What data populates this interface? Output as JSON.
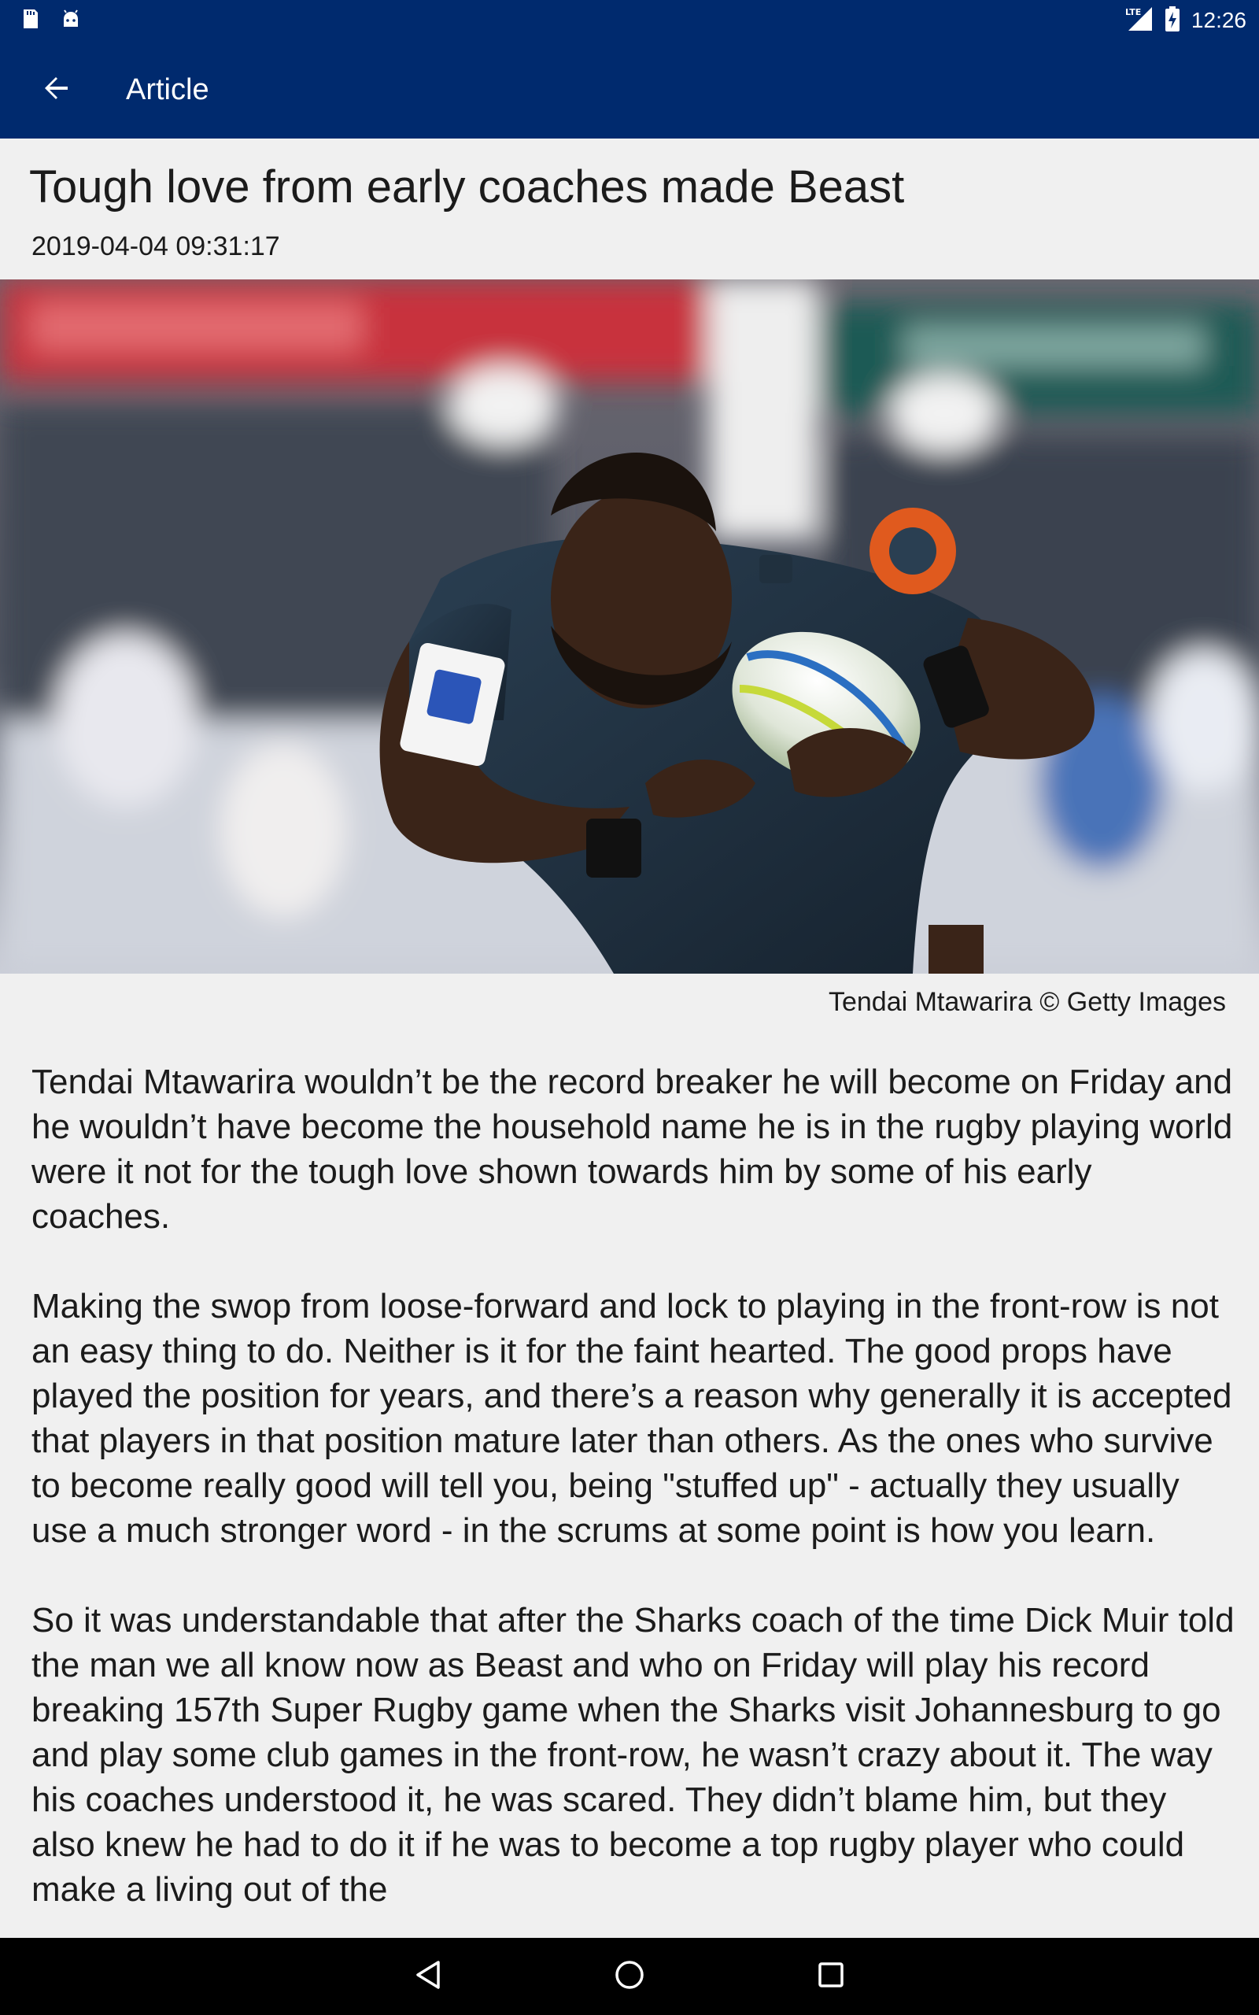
{
  "status_bar": {
    "time": "12:26",
    "left_icons": [
      "sd-card-icon",
      "android-icon"
    ],
    "right_icons": [
      "lte-signal-icon",
      "battery-charging-icon"
    ]
  },
  "app_bar": {
    "title": "Article",
    "back_icon": "arrow-back-icon",
    "background_color": "#002a6e"
  },
  "article": {
    "headline": "Tough love from early coaches made Beast",
    "timestamp": "2019-04-04 09:31:17",
    "image_caption": "Tendai Mtawarira © Getty Images",
    "paragraphs": [
      "Tendai Mtawarira wouldn’t be the record breaker he will become on Friday and he wouldn’t have become the household name he is in the rugby playing world were it not for the tough love shown towards him by some of his early coaches.",
      "Making the swop from loose-forward and lock to playing in the front-row is not an easy thing to do. Neither is it for the faint hearted. The good props have played the position for years, and there’s a reason why generally it is accepted that players in that position mature later than others. As the ones who survive to become really good will tell you, being \"stuffed up\" - actually they usually use a much stronger word - in the scrums at some point is how you learn.",
      "So it was understandable that after the Sharks coach of the time Dick Muir told the man we all know now as Beast and who on Friday will play his record breaking 157th Super Rugby game when the Sharks visit Johannesburg to go and play some club games in the front-row, he wasn’t crazy about it. The way his coaches understood it, he was scared. They didn’t blame him, but they also knew he had to do it if he was to become a top rugby player who could make a living out of the"
    ]
  },
  "nav_bar": {
    "icons": [
      "nav-back-icon",
      "nav-home-icon",
      "nav-recents-icon"
    ]
  }
}
